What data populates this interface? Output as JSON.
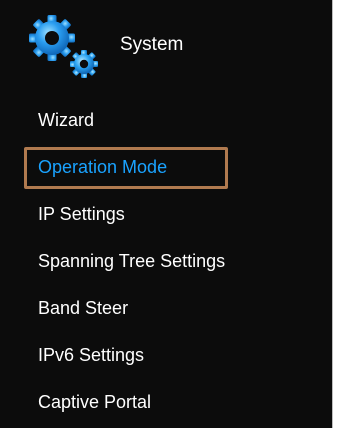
{
  "section": {
    "title": "System",
    "icon": "gears-icon"
  },
  "menu": {
    "items": [
      {
        "label": "Wizard"
      },
      {
        "label": "Operation Mode",
        "active": true
      },
      {
        "label": "IP Settings"
      },
      {
        "label": "Spanning Tree Settings"
      },
      {
        "label": "Band Steer"
      },
      {
        "label": "IPv6 Settings"
      },
      {
        "label": "Captive Portal"
      }
    ]
  },
  "colors": {
    "background": "#0c0c0c",
    "text": "#ffffff",
    "active_text": "#1aa3ff",
    "highlight_border": "#b07a4f",
    "gear": "#1e8fe0"
  }
}
